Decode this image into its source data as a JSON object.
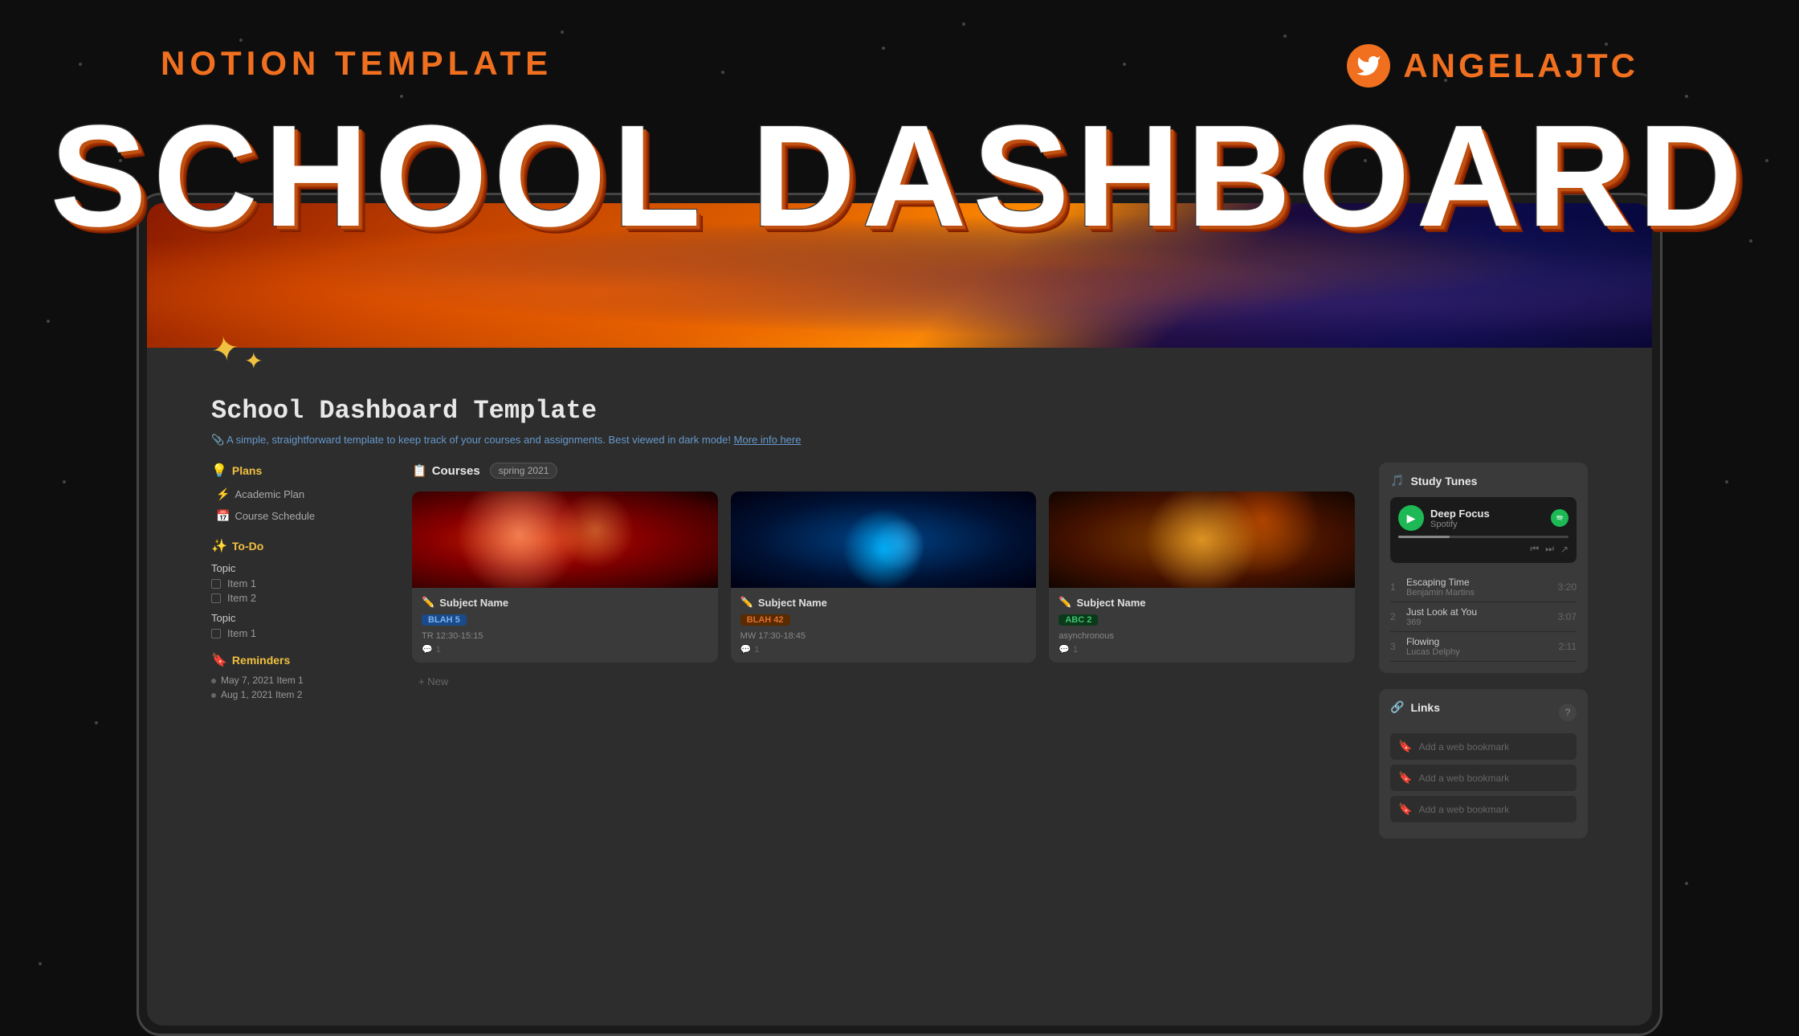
{
  "background": {
    "color": "#0e0e0e"
  },
  "header": {
    "notion_label": "NOTION TEMPLATE",
    "main_title": "SCHOOL DASHBOARD",
    "twitter_handle": "ANGELAJTC"
  },
  "notion_dashboard": {
    "title": "School Dashboard Template",
    "subtitle": "A simple, straightforward template to keep track of your courses and assignments. Best viewed in dark mode!",
    "subtitle_link": "More info here",
    "icon": "✦",
    "left_panel": {
      "plans_label": "Plans",
      "plans_icon": "💡",
      "plans_items": [
        {
          "icon": "⚡",
          "label": "Academic Plan"
        },
        {
          "icon": "📅",
          "label": "Course Schedule"
        }
      ],
      "todo_label": "To-Do",
      "todo_icon": "✨",
      "todo_groups": [
        {
          "topic": "Topic",
          "items": [
            "Item 1",
            "Item 2"
          ]
        },
        {
          "topic": "Topic",
          "items": [
            "Item 1"
          ]
        }
      ],
      "reminders_label": "Reminders",
      "reminders_icon": "🔖",
      "reminders": [
        "May 7, 2021  Item 1",
        "Aug 1, 2021  Item 2"
      ]
    },
    "middle_panel": {
      "courses_label": "Courses",
      "courses_icon": "📋",
      "filter_label": "spring 2021",
      "courses": [
        {
          "name": "Subject Name",
          "tag": "BLAH 5",
          "tag_color": "blue",
          "schedule": "TR 12:30-15:15",
          "comments": "1",
          "thumb": "1"
        },
        {
          "name": "Subject Name",
          "tag": "BLAH 42",
          "tag_color": "orange",
          "schedule": "MW 17:30-18:45",
          "comments": "1",
          "thumb": "2"
        },
        {
          "name": "Subject Name",
          "tag": "ABC 2",
          "tag_color": "green",
          "schedule": "asynchronous",
          "comments": "1",
          "thumb": "3"
        }
      ],
      "add_new_label": "+ New"
    },
    "right_panel": {
      "study_tunes_label": "Study Tunes",
      "study_tunes_icon": "🎵",
      "player": {
        "playlist_name": "Deep Focus",
        "platform": "Spotify",
        "tracks": [
          {
            "num": "1",
            "name": "Escaping Time",
            "artist": "Benjamin Martins",
            "duration": "3:20"
          },
          {
            "num": "2",
            "name": "Just Look at You",
            "artist": "369",
            "duration": "3:07"
          },
          {
            "num": "3",
            "name": "Flowing",
            "artist": "Lucas Delphy",
            "duration": "2:11"
          }
        ]
      },
      "links_label": "Links",
      "links_icon": "🔗",
      "links": [
        "Add a web bookmark",
        "Add a web bookmark",
        "Add a web bookmark"
      ]
    }
  },
  "sparkle_icon_1": "✦",
  "sparkle_icon_2": "✦"
}
